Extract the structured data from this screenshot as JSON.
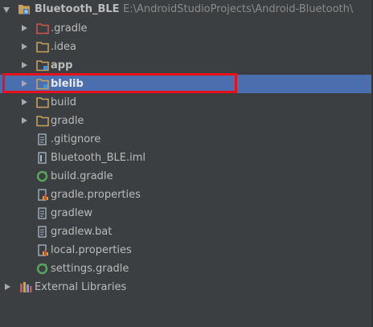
{
  "project": {
    "name": "Bluetooth_BLE",
    "path": "E:\\AndroidStudioProjects\\Android-Bluetooth\\"
  },
  "tree": {
    "items": [
      {
        "label": ".gradle",
        "icon": "folder-excluded-icon",
        "expandable": true
      },
      {
        "label": ".idea",
        "icon": "folder-icon",
        "expandable": true
      },
      {
        "label": "app",
        "icon": "module-folder-icon",
        "expandable": true
      },
      {
        "label": "blelib",
        "icon": "module-folder-icon",
        "expandable": true,
        "selected": true
      },
      {
        "label": "build",
        "icon": "folder-icon",
        "expandable": true
      },
      {
        "label": "gradle",
        "icon": "folder-icon",
        "expandable": true
      },
      {
        "label": ".gitignore",
        "icon": "text-file-icon",
        "expandable": false
      },
      {
        "label": "Bluetooth_BLE.iml",
        "icon": "iml-file-icon",
        "expandable": false
      },
      {
        "label": "build.gradle",
        "icon": "gradle-file-icon",
        "expandable": false
      },
      {
        "label": "gradle.properties",
        "icon": "properties-file-icon",
        "expandable": false
      },
      {
        "label": "gradlew",
        "icon": "text-file-icon",
        "expandable": false
      },
      {
        "label": "gradlew.bat",
        "icon": "text-file-icon",
        "expandable": false
      },
      {
        "label": "local.properties",
        "icon": "properties-file-icon",
        "expandable": false
      },
      {
        "label": "settings.gradle",
        "icon": "gradle-file-icon",
        "expandable": false
      }
    ],
    "external_libraries": "External Libraries"
  },
  "colors": {
    "background": "#3c3f41",
    "selection": "#4b6eaf",
    "highlight_border": "#e8101b",
    "folder": "#c8a05a",
    "excluded_folder": "#d0554a",
    "text": "#bbbbbb"
  }
}
